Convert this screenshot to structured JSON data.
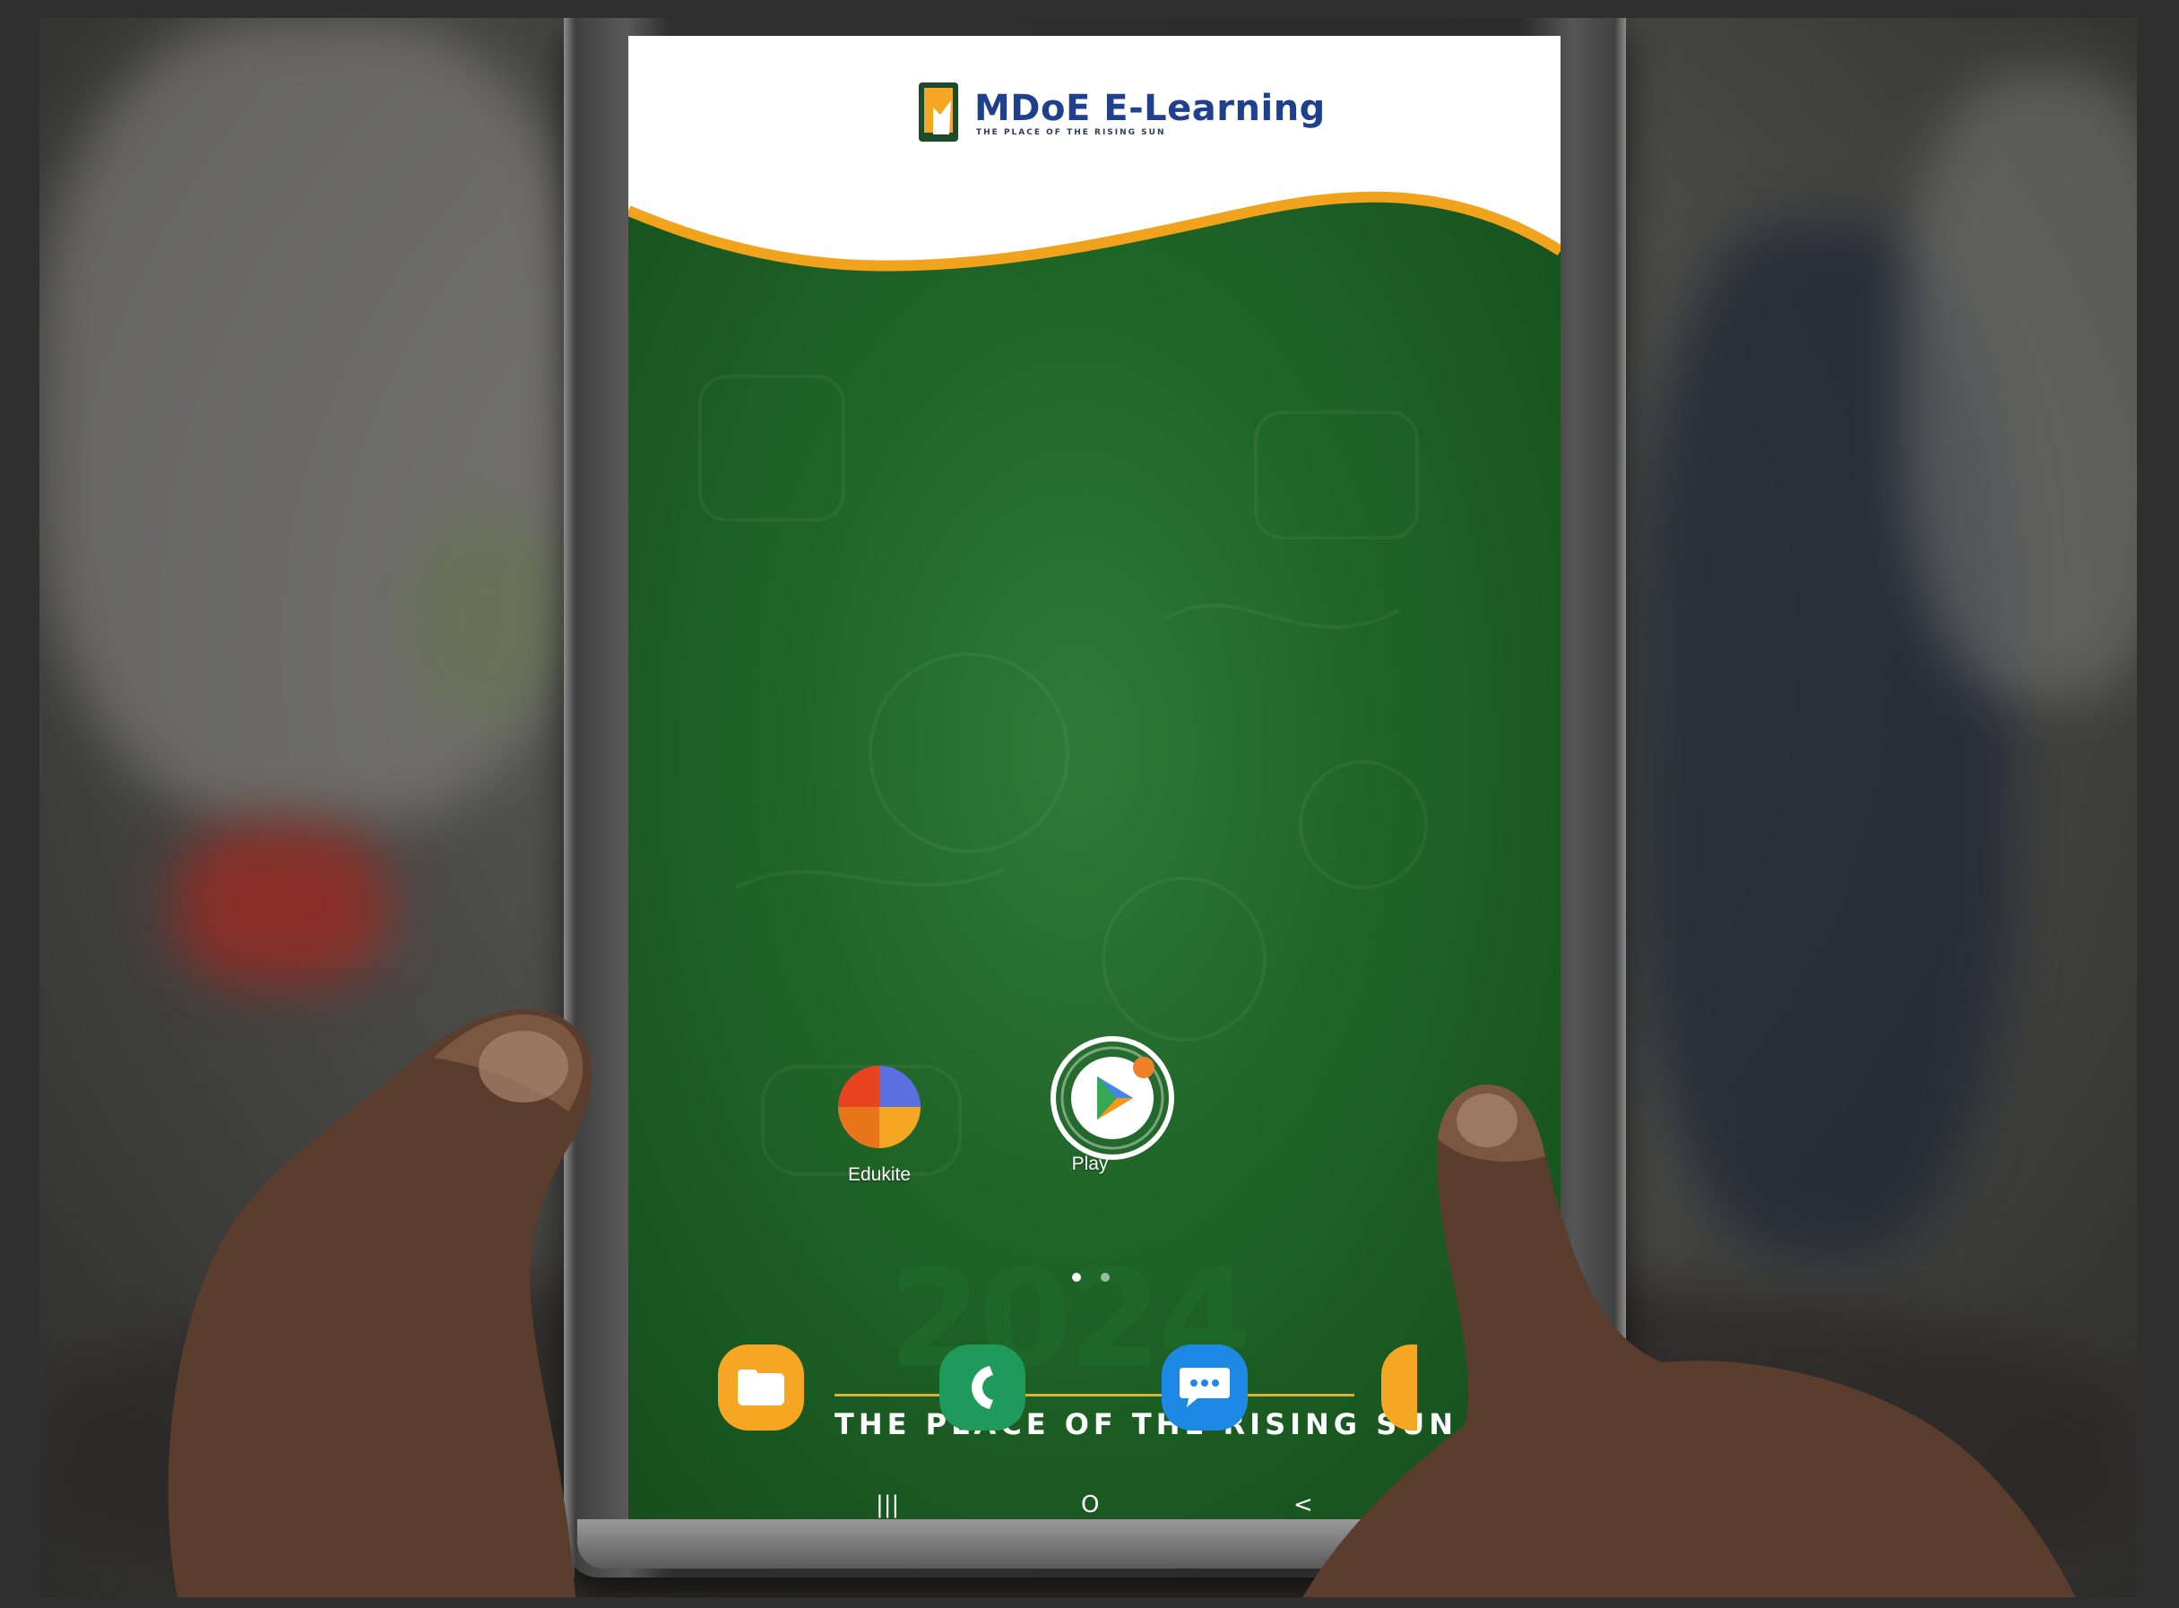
{
  "header": {
    "app_name": "MDoE E-Learning",
    "tagline": "THE PLACE OF THE RISING SUN"
  },
  "home_screen": {
    "apps": [
      {
        "label": "Edukite",
        "icon": "edukite-icon"
      },
      {
        "label": "Play",
        "icon": "play-store-icon"
      }
    ],
    "page_indicator": {
      "current": 1,
      "total": 2
    },
    "wallpaper": {
      "year": "2024",
      "slogan": "THE PLACE OF THE RISING SUN"
    },
    "dock": [
      {
        "icon": "folder-icon"
      },
      {
        "icon": "phone-icon"
      },
      {
        "icon": "messages-icon"
      }
    ]
  },
  "navigation": {
    "recent": "|||",
    "home": "O",
    "back": "<"
  },
  "colors": {
    "screen_green": "#1f6427",
    "accent_orange": "#f5a623",
    "brand_blue": "#1f3f8f"
  }
}
